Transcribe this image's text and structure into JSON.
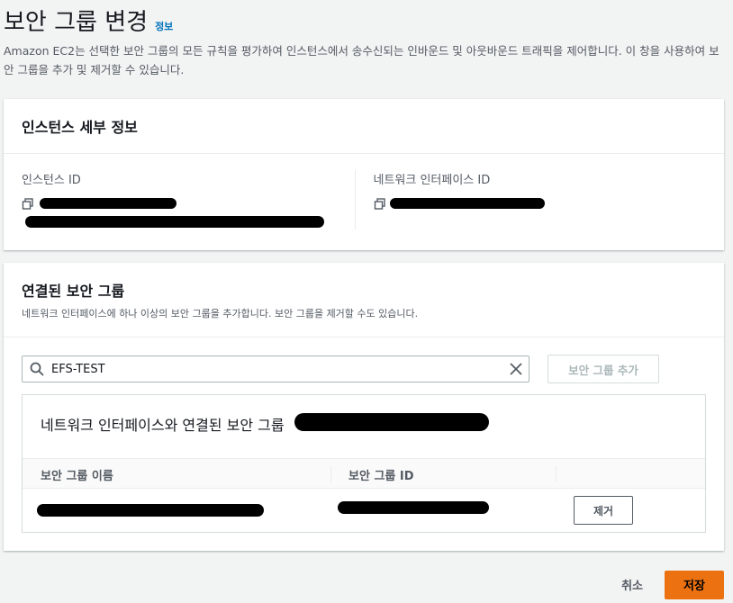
{
  "header": {
    "title": "보안 그룹 변경",
    "info_link": "정보",
    "description": "Amazon EC2는 선택한 보안 그룹의 모든 규칙을 평가하여 인스턴스에서 송수신되는 인바운드 및 아웃바운드 트래픽을 제어합니다. 이 창을 사용하여 보안 그룹을 추가 및 제거할 수 있습니다."
  },
  "instance_details": {
    "title": "인스턴스 세부 정보",
    "instance_id_label": "인스턴스 ID",
    "network_interface_id_label": "네트워크 인터페이스 ID"
  },
  "associated_groups": {
    "title": "연결된 보안 그룹",
    "subtitle": "네트워크 인터페이스에 하나 이상의 보안 그룹을 추가합니다. 보안 그룹을 제거할 수도 있습니다.",
    "search": {
      "value": "EFS-TEST"
    },
    "add_button": "보안 그룹 추가",
    "table": {
      "title": "네트워크 인터페이스와 연결된 보안 그룹",
      "columns": [
        "보안 그룹 이름",
        "보안 그룹 ID"
      ],
      "remove_button": "제거"
    }
  },
  "footer": {
    "cancel": "취소",
    "save": "저장"
  },
  "colors": {
    "primary": "#ec7211",
    "link": "#0073bb",
    "background": "#f2f3f3"
  },
  "icons": [
    "copy-icon",
    "search-icon",
    "close-icon"
  ]
}
